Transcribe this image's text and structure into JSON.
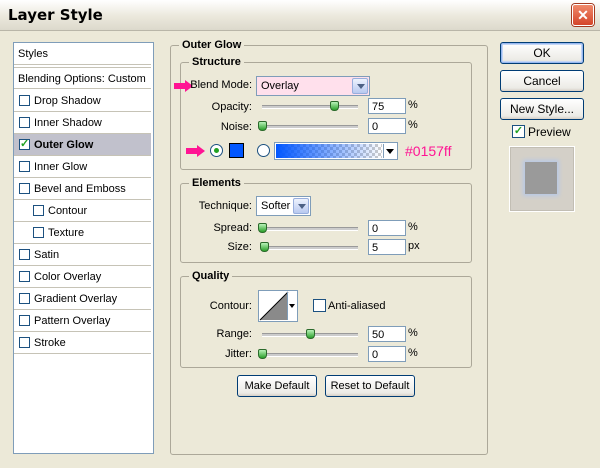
{
  "window": {
    "title": "Layer Style",
    "close_glyph": "✕"
  },
  "styles": {
    "header": "Styles",
    "blending": "Blending Options: Custom",
    "items": [
      {
        "label": "Drop Shadow",
        "checked": false,
        "indent": false
      },
      {
        "label": "Inner Shadow",
        "checked": false,
        "indent": false
      },
      {
        "label": "Outer Glow",
        "checked": true,
        "indent": false,
        "selected": true
      },
      {
        "label": "Inner Glow",
        "checked": false,
        "indent": false
      },
      {
        "label": "Bevel and Emboss",
        "checked": false,
        "indent": false
      },
      {
        "label": "Contour",
        "checked": false,
        "indent": true
      },
      {
        "label": "Texture",
        "checked": false,
        "indent": true
      },
      {
        "label": "Satin",
        "checked": false,
        "indent": false
      },
      {
        "label": "Color Overlay",
        "checked": false,
        "indent": false
      },
      {
        "label": "Gradient Overlay",
        "checked": false,
        "indent": false
      },
      {
        "label": "Pattern Overlay",
        "checked": false,
        "indent": false
      },
      {
        "label": "Stroke",
        "checked": false,
        "indent": false
      }
    ]
  },
  "panel": {
    "title": "Outer Glow"
  },
  "structure": {
    "title": "Structure",
    "blend_mode_label": "Blend Mode:",
    "blend_mode_value": "Overlay",
    "opacity_label": "Opacity:",
    "opacity_value": "75",
    "opacity_unit": "%",
    "opacity_fraction": 0.75,
    "noise_label": "Noise:",
    "noise_value": "0",
    "noise_unit": "%",
    "noise_fraction": 0,
    "color_hex_note": "#0157ff",
    "glow_color": "#0157ff"
  },
  "elements": {
    "title": "Elements",
    "technique_label": "Technique:",
    "technique_value": "Softer",
    "spread_label": "Spread:",
    "spread_value": "0",
    "spread_unit": "%",
    "spread_fraction": 0,
    "size_label": "Size:",
    "size_value": "5",
    "size_unit": "px",
    "size_fraction": 0.02
  },
  "quality": {
    "title": "Quality",
    "contour_label": "Contour:",
    "anti_aliased_label": "Anti-aliased",
    "anti_aliased": false,
    "range_label": "Range:",
    "range_value": "50",
    "range_unit": "%",
    "range_fraction": 0.5,
    "jitter_label": "Jitter:",
    "jitter_value": "0",
    "jitter_unit": "%",
    "jitter_fraction": 0
  },
  "actions": {
    "make_default": "Make Default",
    "reset_default": "Reset to Default"
  },
  "buttons": {
    "ok": "OK",
    "cancel": "Cancel",
    "new_style": "New Style...",
    "preview": "Preview",
    "preview_checked": true
  },
  "colors": {
    "annotation_pink": "#ff1493",
    "list_selected": "#c1c1cc"
  }
}
